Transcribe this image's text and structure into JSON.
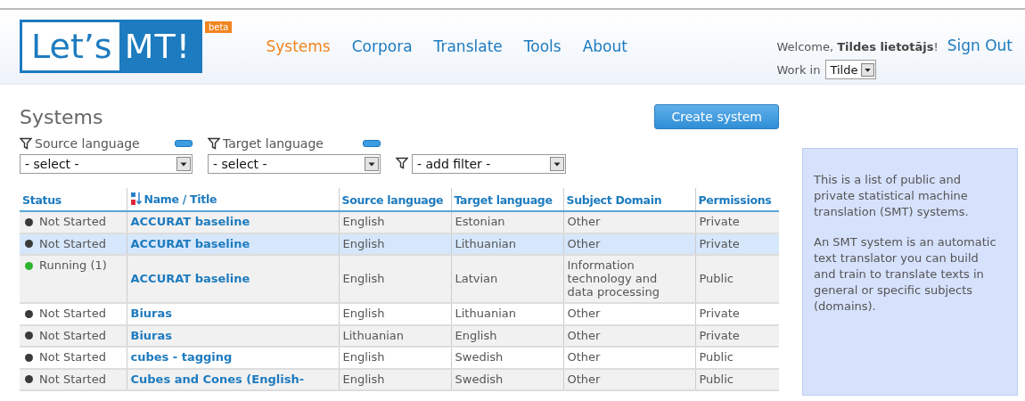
{
  "header": {
    "logo": {
      "left": "Let’s",
      "right": "MT!",
      "badge": "beta"
    },
    "nav": [
      {
        "label": "Systems",
        "selected": true
      },
      {
        "label": "Corpora",
        "selected": false
      },
      {
        "label": "Translate",
        "selected": false
      },
      {
        "label": "Tools",
        "selected": false
      },
      {
        "label": "About",
        "selected": false
      }
    ],
    "welcome": {
      "prefix": "Welcome,",
      "user": "Tildes lietotājs",
      "suffix": "!"
    },
    "sign_out": "Sign Out",
    "work_in": {
      "label": "Work in",
      "value": "Tilde"
    }
  },
  "page_title": "Systems",
  "create_button": "Create system",
  "filters": [
    {
      "label": "Source language",
      "value": "- select -"
    },
    {
      "label": "Target language",
      "value": "- select -"
    }
  ],
  "add_filter": "- add filter -",
  "table": {
    "columns": [
      "Status",
      "Name / Title",
      "Source language",
      "Target language",
      "Subject Domain",
      "Permissions"
    ],
    "rows": [
      {
        "status": "Not Started",
        "color": "#3a3a3a",
        "name": "ACCURAT baseline",
        "source": "English",
        "target": "Estonian",
        "domain": "Other",
        "permission": "Private",
        "selected": false
      },
      {
        "status": "Not Started",
        "color": "#3a3a3a",
        "name": "ACCURAT baseline",
        "source": "English",
        "target": "Lithuanian",
        "domain": "Other",
        "permission": "Private",
        "selected": true
      },
      {
        "status": "Running (1)",
        "color": "#2db52d",
        "name": "ACCURAT baseline",
        "source": "English",
        "target": "Latvian",
        "domain": "Information technology and data processing",
        "permission": "Public",
        "selected": false
      },
      {
        "status": "Not Started",
        "color": "#3a3a3a",
        "name": "Biuras",
        "source": "English",
        "target": "Lithuanian",
        "domain": "Other",
        "permission": "Private",
        "selected": false
      },
      {
        "status": "Not Started",
        "color": "#3a3a3a",
        "name": "Biuras",
        "source": "Lithuanian",
        "target": "English",
        "domain": "Other",
        "permission": "Private",
        "selected": false
      },
      {
        "status": "Not Started",
        "color": "#3a3a3a",
        "name": "cubes - tagging",
        "source": "English",
        "target": "Swedish",
        "domain": "Other",
        "permission": "Public",
        "selected": false
      },
      {
        "status": "Not Started",
        "color": "#3a3a3a",
        "name": "Cubes and Cones (English-",
        "source": "English",
        "target": "Swedish",
        "domain": "Other",
        "permission": "Public",
        "selected": false
      }
    ]
  },
  "info": [
    "This is a list of public and private statistical machine translation (SMT) systems.",
    "An SMT system is an automatic text translator you can build and train to translate texts in general or specific subjects (domains)."
  ]
}
